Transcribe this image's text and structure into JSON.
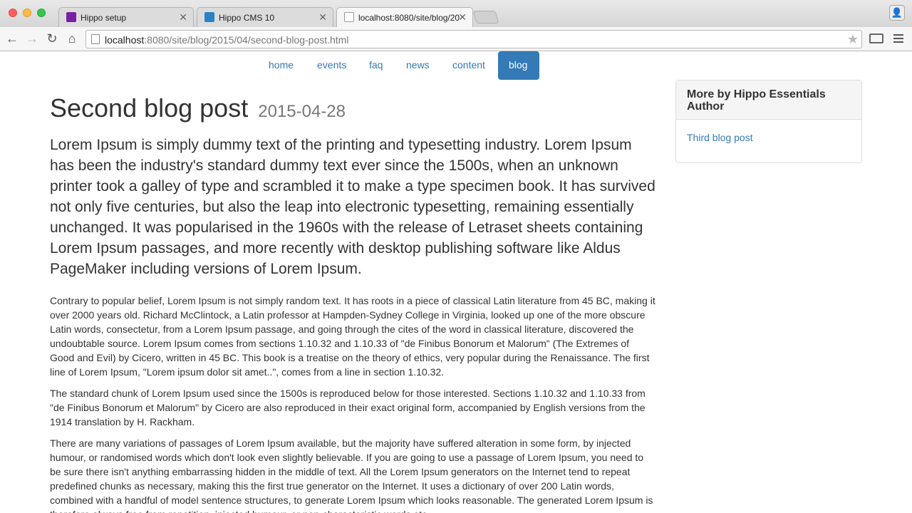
{
  "browser": {
    "tabs": [
      {
        "title": "Hippo setup",
        "icon": "hippo-icon",
        "color": "#7a1fa2"
      },
      {
        "title": "Hippo CMS 10",
        "icon": "hippo-cms-icon",
        "color": "#2a82c7"
      },
      {
        "title": "localhost:8080/site/blog/20",
        "icon": "page-icon",
        "color": "#ffffff"
      }
    ],
    "url_host": "localhost",
    "url_rest": ":8080/site/blog/2015/04/second-blog-post.html"
  },
  "site_nav": {
    "items": [
      "home",
      "events",
      "faq",
      "news",
      "content",
      "blog"
    ],
    "active": "blog",
    "accent": "#337ab7"
  },
  "article": {
    "title": "Second blog post",
    "date": "2015-04-28",
    "lead": "Lorem Ipsum is simply dummy text of the printing and typesetting industry. Lorem Ipsum has been the industry's standard dummy text ever since the 1500s, when an unknown printer took a galley of type and scrambled it to make a type specimen book. It has survived not only five centuries, but also the leap into electronic typesetting, remaining essentially unchanged. It was popularised in the 1960s with the release of Letraset sheets containing Lorem Ipsum passages, and more recently with desktop publishing software like Aldus PageMaker including versions of Lorem Ipsum.",
    "paragraphs": [
      "Contrary to popular belief, Lorem Ipsum is not simply random text. It has roots in a piece of classical Latin literature from 45 BC, making it over 2000 years old. Richard McClintock, a Latin professor at Hampden-Sydney College in Virginia, looked up one of the more obscure Latin words, consectetur, from a Lorem Ipsum passage, and going through the cites of the word in classical literature, discovered the undoubtable source. Lorem Ipsum comes from sections 1.10.32 and 1.10.33 of \"de Finibus Bonorum et Malorum\" (The Extremes of Good and Evil) by Cicero, written in 45 BC. This book is a treatise on the theory of ethics, very popular during the Renaissance. The first line of Lorem Ipsum, \"Lorem ipsum dolor sit amet..\", comes from a line in section 1.10.32.",
      "The standard chunk of Lorem Ipsum used since the 1500s is reproduced below for those interested. Sections 1.10.32 and 1.10.33 from \"de Finibus Bonorum et Malorum\" by Cicero are also reproduced in their exact original form, accompanied by English versions from the 1914 translation by H. Rackham.",
      "There are many variations of passages of Lorem Ipsum available, but the majority have suffered alteration in some form, by injected humour, or randomised words which don't look even slightly believable. If you are going to use a passage of Lorem Ipsum, you need to be sure there isn't anything embarrassing hidden in the middle of text. All the Lorem Ipsum generators on the Internet tend to repeat predefined chunks as necessary, making this the first true generator on the Internet. It uses a dictionary of over 200 Latin words, combined with a handful of model sentence structures, to generate Lorem Ipsum which looks reasonable. The generated Lorem Ipsum is therefore always free from repetition, injected humour, or non-characteristic words etc."
    ]
  },
  "sidebar": {
    "heading": "More by Hippo Essentials Author",
    "links": [
      "Third blog post"
    ]
  }
}
